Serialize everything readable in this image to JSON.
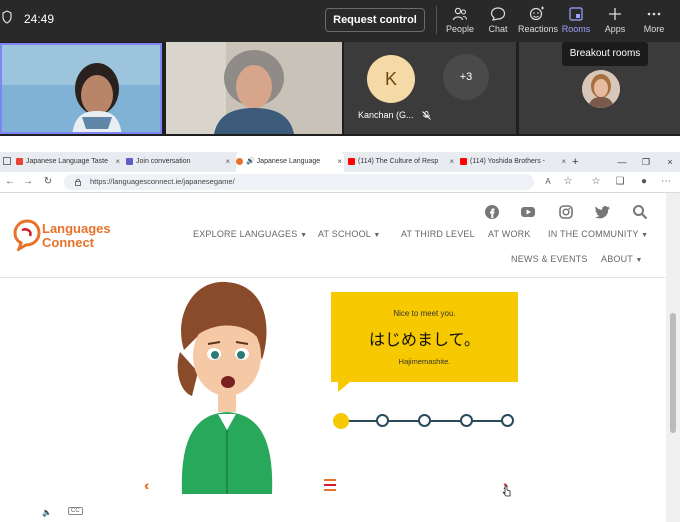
{
  "teams": {
    "timer": "24:49",
    "request_control": "Request control",
    "buttons": [
      {
        "label": "People",
        "icon": "people-icon"
      },
      {
        "label": "Chat",
        "icon": "chat-icon"
      },
      {
        "label": "Reactions",
        "icon": "reactions-icon"
      },
      {
        "label": "Rooms",
        "icon": "rooms-icon"
      },
      {
        "label": "Apps",
        "icon": "apps-icon"
      },
      {
        "label": "More",
        "icon": "more-icon"
      }
    ],
    "tooltip": "Breakout rooms",
    "participant_initial": "K",
    "participant_name": "Kanchan (G...",
    "more_participants": "+3",
    "accent": "#7f85f5"
  },
  "browser": {
    "tabs": [
      {
        "label": "Japanese Language Taste"
      },
      {
        "label": "Join conversation"
      },
      {
        "label": "Japanese Language"
      },
      {
        "label": "(114) The Culture of Resp"
      },
      {
        "label": "(114) Yoshida Brothers - "
      }
    ],
    "new_tab": "+",
    "url": "https://languagesconnect.ie/japanesegame/"
  },
  "site": {
    "logo_line1": "Languages",
    "logo_line2": "Connect",
    "nav": {
      "explore": "EXPLORE LANGUAGES",
      "school": "AT SCHOOL",
      "third_level": "AT THIRD LEVEL",
      "work": "AT WORK",
      "community": "IN THE COMMUNITY",
      "news": "NEWS & EVENTS",
      "about": "ABOUT"
    },
    "brand_orange": "#e8722a",
    "brand_yellow": "#f7c900"
  },
  "game": {
    "english": "Nice to meet you.",
    "japanese": "はじめまして。",
    "romaji": "Hajimemashite.",
    "progress": {
      "current": 1,
      "total": 5
    },
    "cc": "CC"
  }
}
